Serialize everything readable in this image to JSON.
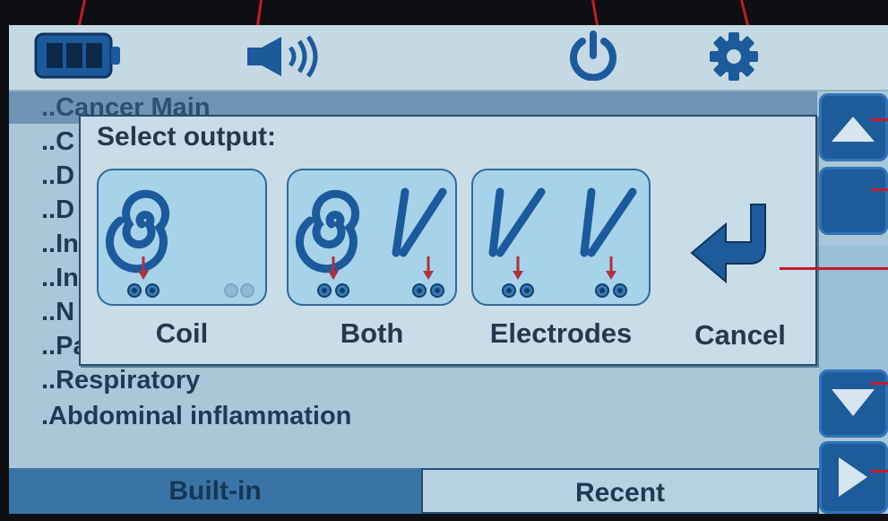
{
  "dialog": {
    "title": "Select output:",
    "options": [
      {
        "label": "Coil"
      },
      {
        "label": "Both"
      },
      {
        "label": "Electrodes"
      },
      {
        "label": "Cancel"
      }
    ]
  },
  "list": {
    "items": [
      "..Cancer Main",
      "..C",
      "..D",
      "..D",
      "..In",
      "..In",
      "..N",
      "..Parasites general",
      "..Respiratory",
      ".Abdominal inflammation"
    ],
    "selected_index": 0
  },
  "tabs": [
    {
      "label": "Built-in",
      "active": true
    },
    {
      "label": "Recent",
      "active": false
    }
  ],
  "topbar": {
    "icons": [
      "battery-icon",
      "speaker-icon",
      "power-icon",
      "gear-icon"
    ]
  },
  "colors": {
    "screen_bg": "#a9c7d8",
    "accent_blue": "#1e5b9a",
    "callout_red": "#c61a2a",
    "selected_row": "#6f93b6"
  }
}
